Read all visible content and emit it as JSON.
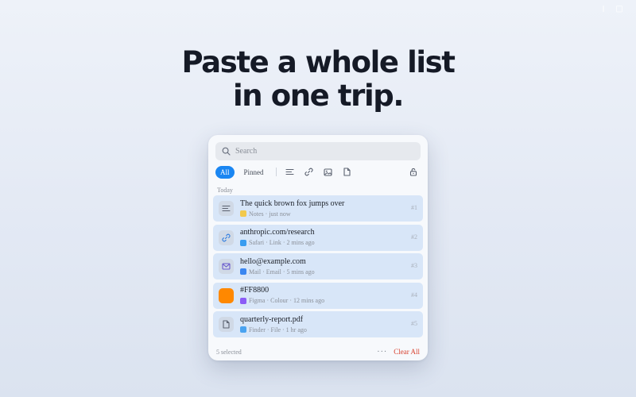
{
  "headline": {
    "line1": "Paste a whole list",
    "line2": "in one trip."
  },
  "search": {
    "placeholder": "Search"
  },
  "filters": {
    "all": "All",
    "pinned": "Pinned",
    "icons": [
      "text-icon",
      "link-icon",
      "image-icon",
      "file-icon"
    ]
  },
  "section": "Today",
  "items": [
    {
      "icon": "text-icon",
      "title": "The quick brown fox jumps over",
      "meta": "Notes · just now",
      "app_color": "#f2c94c",
      "num": "#1"
    },
    {
      "icon": "link-icon",
      "title": "anthropic.com/research",
      "meta": "Safari · Link · 2 mins ago",
      "app_color": "#3a9df0",
      "num": "#2"
    },
    {
      "icon": "mail-icon",
      "title": "hello@example.com",
      "meta": "Mail · Email · 5 mins ago",
      "app_color": "#3a86f0",
      "num": "#3"
    },
    {
      "icon": "color-swatch",
      "title": "#FF8800",
      "meta": "Figma · Colour · 12 mins ago",
      "app_color": "#8b5cf6",
      "num": "#4",
      "swatch": "#FF8800"
    },
    {
      "icon": "file-icon",
      "title": "quarterly-report.pdf",
      "meta": "Finder · File · 1 hr ago",
      "app_color": "#4aa3f0",
      "num": "#5"
    }
  ],
  "footer": {
    "selected": "5 selected",
    "more": "···",
    "clear": "Clear All"
  },
  "colors": {
    "accent": "#1a86f2",
    "danger": "#d8412f",
    "row_bg": "#d8e6f8"
  }
}
